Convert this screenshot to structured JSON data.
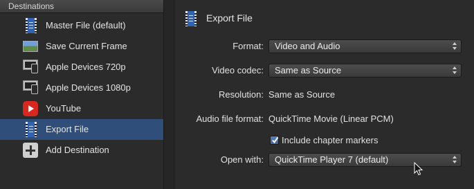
{
  "sidebar": {
    "header": "Destinations",
    "items": [
      {
        "label": "Master File (default)",
        "icon": "film-icon"
      },
      {
        "label": "Save Current Frame",
        "icon": "landscape-image-icon"
      },
      {
        "label": "Apple Devices 720p",
        "icon": "apple-devices-icon"
      },
      {
        "label": "Apple Devices 1080p",
        "icon": "apple-devices-icon"
      },
      {
        "label": "YouTube",
        "icon": "youtube-icon"
      },
      {
        "label": "Export File",
        "icon": "film-icon",
        "selected": true
      },
      {
        "label": "Add Destination",
        "icon": "add-icon"
      }
    ]
  },
  "panel": {
    "title": "Export File",
    "format_label": "Format:",
    "format_value": "Video and Audio",
    "video_codec_label": "Video codec:",
    "video_codec_value": "Same as Source",
    "resolution_label": "Resolution:",
    "resolution_value": "Same as Source",
    "audio_format_label": "Audio file format:",
    "audio_format_value": "QuickTime Movie (Linear PCM)",
    "chapter_markers_label": "Include chapter markers",
    "chapter_markers_checked": true,
    "open_with_label": "Open with:",
    "open_with_value": "QuickTime Player 7 (default)"
  },
  "colors": {
    "selection": "#2f4f7a",
    "film_blue": "#2f63b5",
    "youtube_red": "#d9271f"
  }
}
